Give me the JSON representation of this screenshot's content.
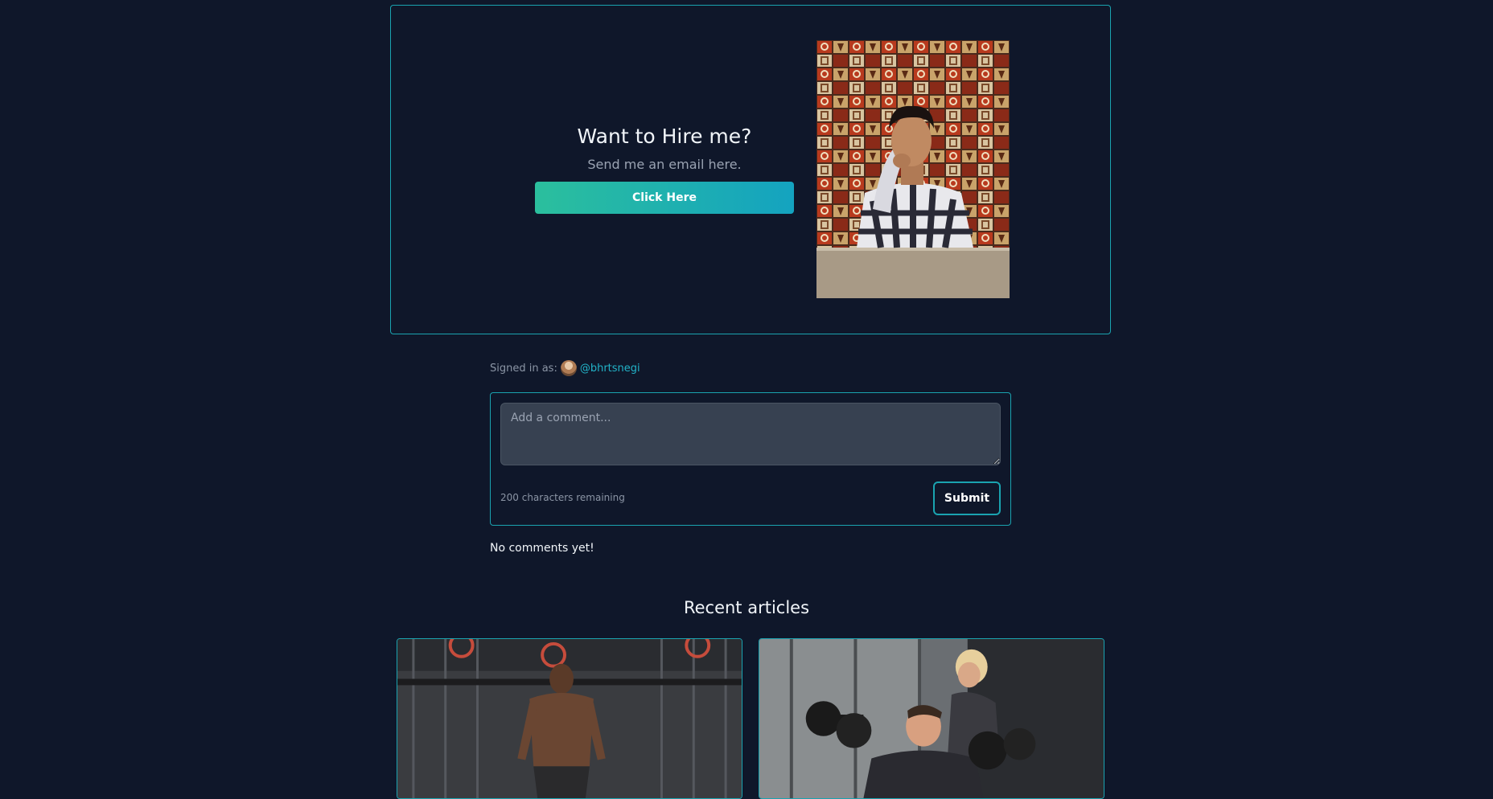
{
  "hire": {
    "title": "Want to Hire me?",
    "subtitle": "Send me an email here.",
    "button_label": "Click Here"
  },
  "comments": {
    "signed_in_label": "Signed in as:",
    "username": "@bhrtsnegi",
    "placeholder": "Add a comment...",
    "chars_remaining": "200 characters remaining",
    "submit_label": "Submit",
    "empty_text": "No comments yet!"
  },
  "recent": {
    "title": "Recent articles"
  },
  "colors": {
    "background": "#0f172a",
    "accent_border": "#1aa3b0",
    "link": "#22b3c8",
    "button_gradient_start": "#2bbf9d",
    "button_gradient_end": "#14a3c0"
  }
}
